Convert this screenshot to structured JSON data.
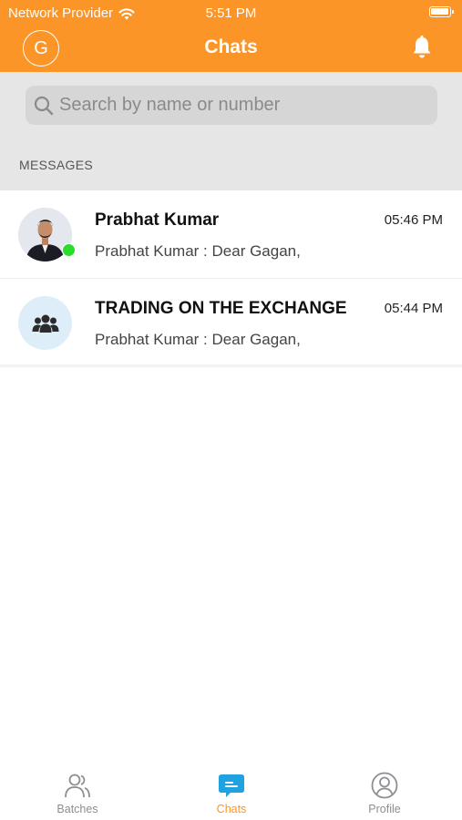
{
  "status_bar": {
    "carrier": "Network Provider",
    "time": "5:51 PM"
  },
  "header": {
    "avatar_letter": "G",
    "title": "Chats"
  },
  "search": {
    "placeholder": "Search by name or number"
  },
  "section_label": "MESSAGES",
  "chats": [
    {
      "name": "Prabhat Kumar",
      "time": "05:46 PM",
      "preview": "Prabhat Kumar : Dear Gagan,"
    },
    {
      "name": "TRADING ON THE EXCHANGE",
      "time": "05:44 PM",
      "preview": "Prabhat Kumar : Dear Gagan,"
    }
  ],
  "tabs": [
    {
      "label": "Batches",
      "icon": "batches-icon"
    },
    {
      "label": "Chats",
      "icon": "chat-bubble-icon"
    },
    {
      "label": "Profile",
      "icon": "profile-icon"
    }
  ],
  "colors": {
    "brand": "#fb9528",
    "online": "#2bdc2b",
    "active_tab_icon": "#1fa2e0"
  }
}
